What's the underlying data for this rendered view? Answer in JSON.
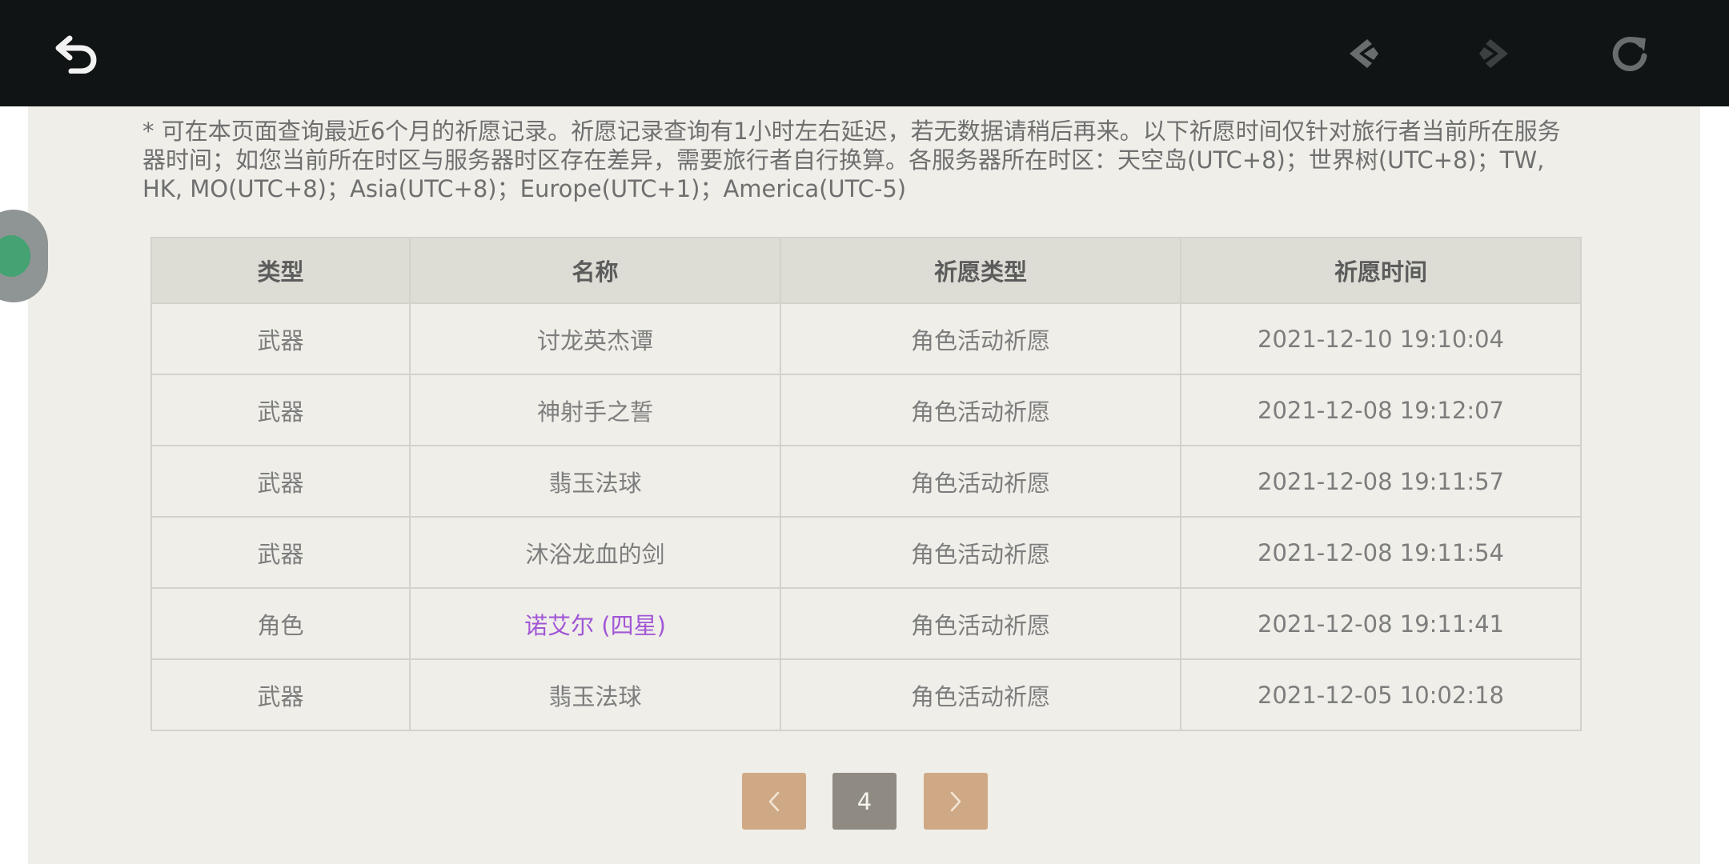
{
  "toolbar": {
    "back_icon": "back-arrow-icon",
    "prev_icon": "chevron-left-icon",
    "next_icon": "chevron-right-icon",
    "refresh_icon": "refresh-icon"
  },
  "notice": "* 可在本页面查询最近6个月的祈愿记录。祈愿记录查询有1小时左右延迟，若无数据请稍后再来。以下祈愿时间仅针对旅行者当前所在服务器时间；如您当前所在时区与服务器时区存在差异，需要旅行者自行换算。各服务器所在时区：天空岛(UTC+8)；世界树(UTC+8)；TW, HK, MO(UTC+8)；Asia(UTC+8)；Europe(UTC+1)；America(UTC-5)",
  "table": {
    "headers": [
      "类型",
      "名称",
      "祈愿类型",
      "祈愿时间"
    ],
    "rows": [
      {
        "type": "武器",
        "name": "讨龙英杰谭",
        "wish_type": "角色活动祈愿",
        "time": "2021-12-10 19:10:04"
      },
      {
        "type": "武器",
        "name": "神射手之誓",
        "wish_type": "角色活动祈愿",
        "time": "2021-12-08 19:12:07"
      },
      {
        "type": "武器",
        "name": "翡玉法球",
        "wish_type": "角色活动祈愿",
        "time": "2021-12-08 19:11:57"
      },
      {
        "type": "武器",
        "name": "沐浴龙血的剑",
        "wish_type": "角色活动祈愿",
        "time": "2021-12-08 19:11:54"
      },
      {
        "type": "角色",
        "name": "诺艾尔 (四星)",
        "wish_type": "角色活动祈愿",
        "time": "2021-12-08 19:11:41"
      },
      {
        "type": "武器",
        "name": "翡玉法球",
        "wish_type": "角色活动祈愿",
        "time": "2021-12-05 10:02:18"
      }
    ]
  },
  "pagination": {
    "current_page": "4",
    "prev_symbol": "‹",
    "next_symbol": "›"
  },
  "colors": {
    "accent_purple": "#a257d6",
    "pager_button": "#cfa985",
    "pager_current": "#8f8b82"
  }
}
